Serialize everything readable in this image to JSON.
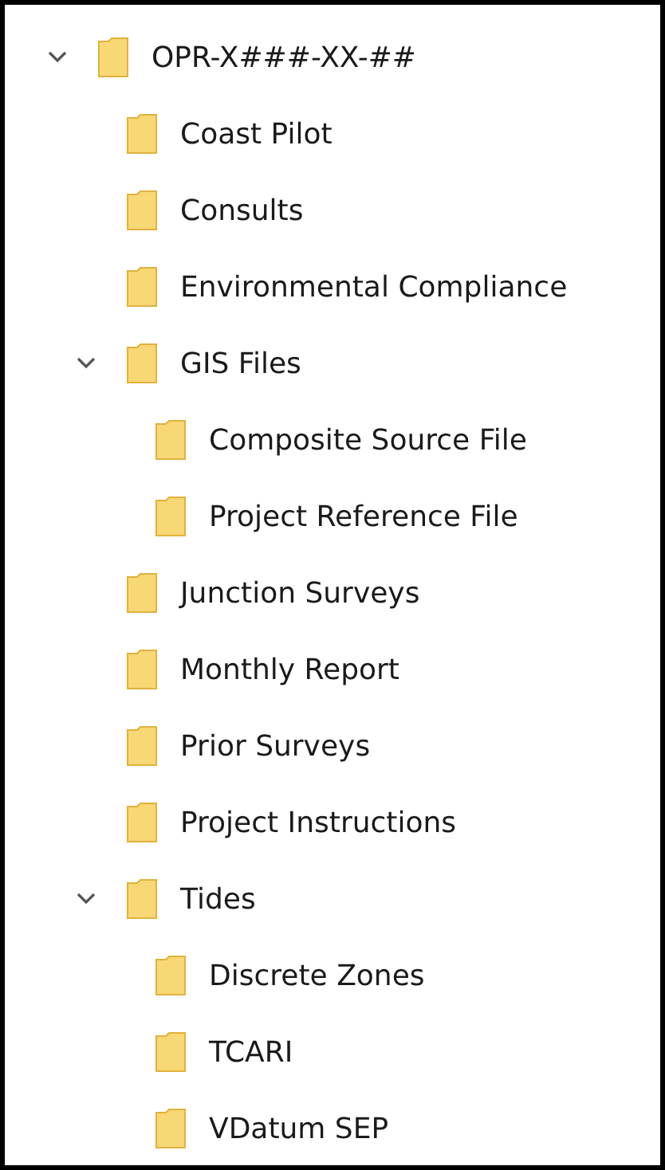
{
  "tree": [
    {
      "label": "OPR-X###-XX-##",
      "expanded": true,
      "children": [
        {
          "label": "Coast Pilot"
        },
        {
          "label": "Consults"
        },
        {
          "label": "Environmental Compliance"
        },
        {
          "label": "GIS Files",
          "expanded": true,
          "children": [
            {
              "label": "Composite Source File"
            },
            {
              "label": "Project Reference File"
            }
          ]
        },
        {
          "label": "Junction Surveys"
        },
        {
          "label": "Monthly Report"
        },
        {
          "label": "Prior Surveys"
        },
        {
          "label": "Project Instructions"
        },
        {
          "label": "Tides",
          "expanded": true,
          "children": [
            {
              "label": "Discrete Zones"
            },
            {
              "label": "TCARI"
            },
            {
              "label": "VDatum SEP"
            }
          ]
        }
      ]
    }
  ]
}
